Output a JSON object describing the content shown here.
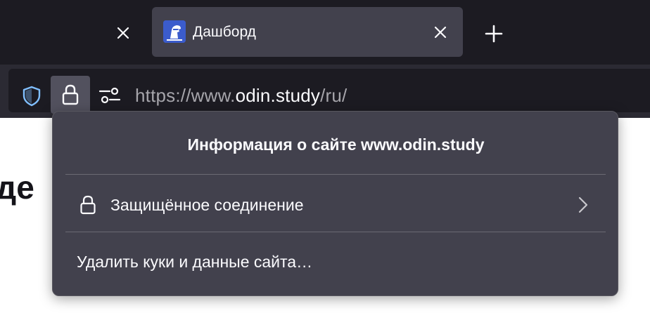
{
  "tabs": {
    "active": {
      "title": "Дашборд",
      "favicon": "odin-favicon"
    },
    "prev_close_icon": "close-icon",
    "active_close_icon": "close-icon",
    "new_tab_icon": "plus-icon"
  },
  "toolbar": {
    "url": {
      "scheme": "https://",
      "prefix": "www.",
      "host": "odin.study",
      "path": "/ru/"
    },
    "icons": {
      "shield": "shield-icon",
      "lock": "lock-icon",
      "permissions": "permissions-icon"
    }
  },
  "page": {
    "heading_fragment": "де"
  },
  "site_info_panel": {
    "title": "Информация о сайте www.odin.study",
    "secure_connection_label": "Защищённое соединение",
    "clear_cookies_label": "Удалить куки и данные сайта…"
  },
  "colors": {
    "tab_bg": "#1c1b22",
    "active_tab": "#42414d",
    "panel_bg": "#42414d",
    "shield_accent": "#80bfff",
    "favicon_bg": "#3b5ccc"
  }
}
